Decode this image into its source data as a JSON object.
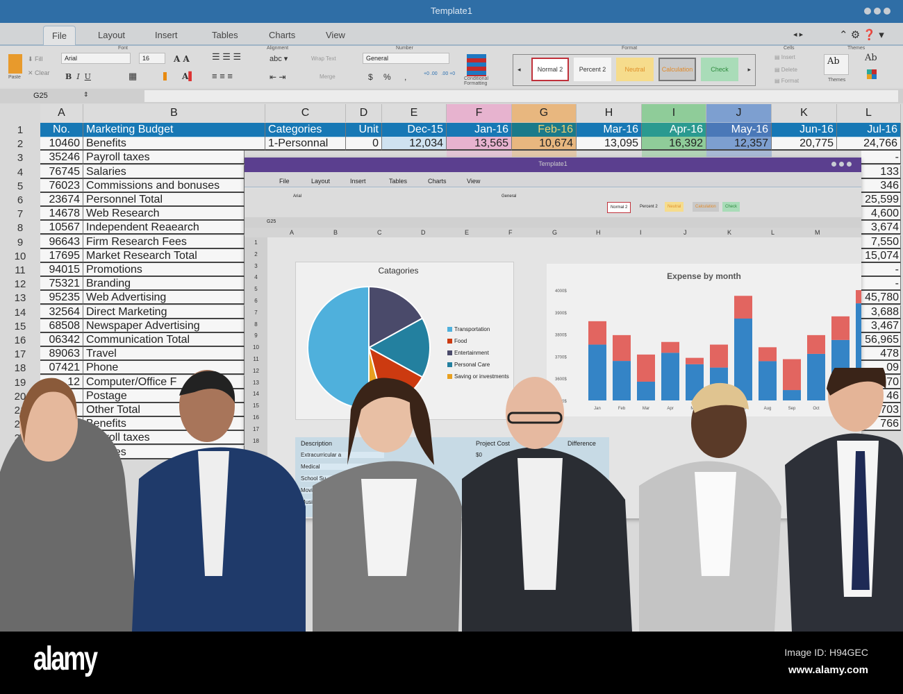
{
  "window": {
    "title": "Template1"
  },
  "tabs": [
    "File",
    "Layout",
    "Insert",
    "Tables",
    "Charts",
    "View"
  ],
  "ribbon": {
    "font_group": "Font",
    "font": "Arial",
    "size": "16",
    "fill": "Fill",
    "clear": "Clear",
    "paste": "Paste",
    "alignment_group": "Alignment",
    "abc": "abc",
    "wrap_text": "Wrap Text",
    "merge": "Merge",
    "number_group": "Number",
    "number_format": "General",
    "currency": "$",
    "percent": "%",
    "comma": ",",
    "conditional_formatting": "Conditional Formatting",
    "format_group": "Format",
    "styles": [
      {
        "label": "Normal 2",
        "color": "#333",
        "bg": "#fff",
        "border": "#c0303a"
      },
      {
        "label": "Percent 2",
        "color": "#333",
        "bg": "#f4f4f4",
        "border": "#f4f4f4"
      },
      {
        "label": "Neutral",
        "color": "#e0902a",
        "bg": "#f6dc8c",
        "border": "#f6dc8c"
      },
      {
        "label": "Calculation",
        "color": "#e08a2a",
        "bg": "#c9c9c9",
        "border": "#777"
      },
      {
        "label": "Check",
        "color": "#2e8b3e",
        "bg": "#a9dcb8",
        "border": "#a9dcb8"
      }
    ],
    "cells_group": "Cells",
    "insert": "Insert",
    "delete": "Delete",
    "format": "Format",
    "themes_group": "Themes",
    "themes": "Themes",
    "ab": "Ab"
  },
  "formula_bar": {
    "cell_ref": "G25",
    "value": ""
  },
  "sheet": {
    "columns": [
      "A",
      "B",
      "C",
      "D",
      "E",
      "F",
      "G",
      "H",
      "I",
      "J",
      "K",
      "L"
    ],
    "column_highlights": {
      "F": "#e7b3cf",
      "G": "#e8b77f",
      "I": "#8fcc99",
      "J": "#7d9fd0"
    },
    "header_row": [
      "No.",
      "Marketing Budget",
      "Categories",
      "Unit",
      "Dec-15",
      "Jan-16",
      "Feb-16",
      "Mar-16",
      "Apr-16",
      "May-16",
      "Jun-16",
      "Jul-16"
    ],
    "row2": [
      "10460",
      "Benefits",
      "1-Personnal",
      "0",
      "12,034",
      "13,565",
      "10,674",
      "13,095",
      "16,392",
      "12,357",
      "20,775",
      "24,766"
    ],
    "rows": [
      {
        "no": "35246",
        "item": "Payroll taxes"
      },
      {
        "no": "76745",
        "item": "Salaries"
      },
      {
        "no": "76023",
        "item": "Commissions and bonuses"
      },
      {
        "no": "23674",
        "item": "Personnel Total"
      },
      {
        "no": "14678",
        "item": "Web Research"
      },
      {
        "no": "10567",
        "item": "Independent Reaearch"
      },
      {
        "no": "96643",
        "item": "Firm Research Fees"
      },
      {
        "no": "17695",
        "item": "Market Research Total"
      },
      {
        "no": "94015",
        "item": "Promotions"
      },
      {
        "no": "75321",
        "item": "Branding"
      },
      {
        "no": "95235",
        "item": "Web Advertising"
      },
      {
        "no": "32564",
        "item": "Direct Marketing"
      },
      {
        "no": "68508",
        "item": "Newspaper Advertising"
      },
      {
        "no": "06342",
        "item": "Communication Total"
      },
      {
        "no": "89063",
        "item": "Travel"
      },
      {
        "no": "07421",
        "item": "Phone"
      },
      {
        "no": "12",
        "item": "Computer/Office F"
      },
      {
        "no": "",
        "item": "Postage"
      },
      {
        "no": "",
        "item": "Other Total"
      },
      {
        "no": "",
        "item": "Benefits"
      },
      {
        "no": "",
        "item": "Payroll taxes"
      },
      {
        "no": "",
        "item": "Salaries"
      }
    ],
    "col_L": [
      "-",
      "133",
      "346",
      "25,599",
      "4,600",
      "3,674",
      "7,550",
      "15,074",
      "-",
      "-",
      "45,780",
      "3,688",
      "3,467",
      "56,965",
      "478",
      "09",
      "70",
      "46",
      "703",
      "766"
    ]
  },
  "inner_window": {
    "title": "Template1",
    "columns": [
      "A",
      "B",
      "C",
      "D",
      "E",
      "F",
      "G",
      "H",
      "I",
      "J",
      "K",
      "L",
      "M"
    ],
    "table_headers": [
      "Description",
      "Project Cost",
      "Difference"
    ],
    "table_rows": [
      "Extracurricular a",
      "Medical",
      "School Su",
      "Movies",
      "Music ("
    ],
    "project_cost": "$0"
  },
  "chart_data": [
    {
      "type": "pie",
      "title": "Catagories",
      "labels": [
        "Transportation",
        "Food",
        "Entertainment",
        "Personal Care",
        "Saving or investments"
      ],
      "values": [
        50,
        13,
        17,
        16,
        4
      ],
      "colors": [
        "#4fb0dc",
        "#cc3a10",
        "#4a4a6a",
        "#23809f",
        "#e8a020"
      ],
      "legend": "right"
    },
    {
      "type": "bar",
      "stacked": true,
      "title": "Expense by month",
      "categories": [
        "Jan",
        "Feb",
        "Mar",
        "Apr",
        "May",
        "Jun",
        "Jul",
        "Aug",
        "Sep",
        "Oct",
        "Nov",
        "Dec"
      ],
      "yticks": [
        "4000$",
        "3900$",
        "3800$",
        "3700$",
        "3600$",
        "3500$"
      ],
      "ylim": [
        3500,
        4000
      ],
      "series": [
        {
          "color": "#1f78c1",
          "values": [
            3753,
            3679,
            3585,
            3716,
            3664,
            3649,
            3871,
            3678,
            3547,
            3711,
            3774,
            3940
          ]
        },
        {
          "color": "#e05550",
          "values": [
            3859,
            3796,
            3708,
            3765,
            3693,
            3753,
            3974,
            3741,
            3687,
            3796,
            3881,
            4000
          ]
        }
      ]
    }
  ],
  "footer": {
    "logo": "alamy",
    "image_id": "Image ID: H94GEC",
    "url": "www.alamy.com"
  }
}
